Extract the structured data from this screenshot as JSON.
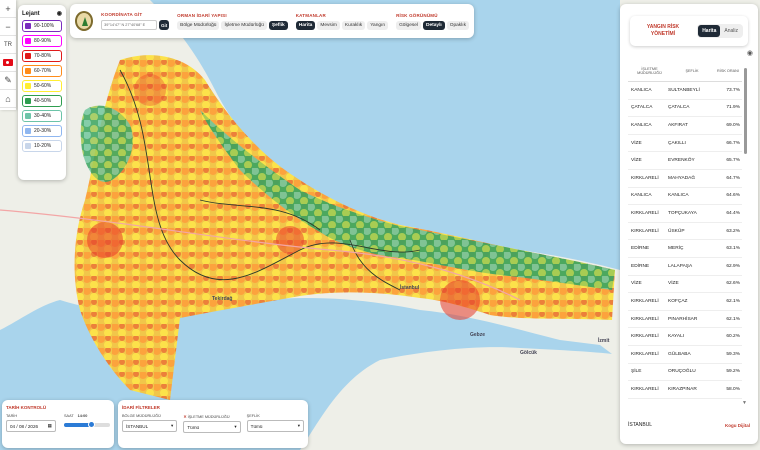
{
  "toolbar_left": {
    "zoom_in": "+",
    "zoom_out": "−",
    "lang": "TR"
  },
  "legend": {
    "title": "Lejant",
    "items": [
      {
        "label": "90-100%",
        "color": "#7b2cbf"
      },
      {
        "label": "80-90%",
        "color": "#ff00ff"
      },
      {
        "label": "70-80%",
        "color": "#e01a1a"
      },
      {
        "label": "60-70%",
        "color": "#ff8c1a"
      },
      {
        "label": "50-60%",
        "color": "#ffee33"
      },
      {
        "label": "40-50%",
        "color": "#2e9e4f"
      },
      {
        "label": "30-40%",
        "color": "#6cc4a8"
      },
      {
        "label": "20-30%",
        "color": "#8fb7f0"
      },
      {
        "label": "10-20%",
        "color": "#c8d6ea"
      }
    ]
  },
  "topbar": {
    "coord_title": "KOORDİNATA GİT",
    "coord_placeholder": "39°14'47\" N 27°40'68\" E",
    "go_label": "Git",
    "unit_title": "ORMAN İDARİ YAPISI",
    "unit_buttons": [
      "Bölge Müdürlüğü",
      "İşletme Müdürlüğü",
      "Şeflik"
    ],
    "layers_title": "KATMANLAR",
    "layer_buttons": [
      "Harita",
      "Mevsim",
      "Kuraklık",
      "Yangın"
    ],
    "view_title": "RİSK GÖRÜNÜMÜ",
    "view_buttons": [
      "Gölgesel",
      "Detaylı",
      "Opaklık"
    ]
  },
  "right_panel": {
    "title": "YANGIN RİSK YÖNETİMİ",
    "tabs": [
      "Harita",
      "Analiz"
    ],
    "columns": [
      "İŞLETME MÜDÜRLÜĞÜ",
      "ŞEFLİK",
      "RİSK ORANI"
    ],
    "rows": [
      [
        "KANLICA",
        "SULTANBEYLİ",
        "73.7%"
      ],
      [
        "ÇATALCA",
        "ÇATALCA",
        "71.9%"
      ],
      [
        "KANLICA",
        "AKFIRAT",
        "69.0%"
      ],
      [
        "VİZE",
        "ÇAKILLI",
        "66.7%"
      ],
      [
        "VİZE",
        "EVRENKÖY",
        "65.7%"
      ],
      [
        "KIRKLARELİ",
        "MAHYADAĞ",
        "64.7%"
      ],
      [
        "KANLICA",
        "KANLICA",
        "64.6%"
      ],
      [
        "KIRKLARELİ",
        "TOPÇUKAYA",
        "64.4%"
      ],
      [
        "KIRKLARELİ",
        "ÜSKÜP",
        "63.2%"
      ],
      [
        "EDİRNE",
        "MERİÇ",
        "63.1%"
      ],
      [
        "EDİRNE",
        "LALAPAŞA",
        "62.9%"
      ],
      [
        "VİZE",
        "VİZE",
        "62.6%"
      ],
      [
        "KIRKLARELİ",
        "KOFÇAZ",
        "62.1%"
      ],
      [
        "KIRKLARELİ",
        "PINARHİSAR",
        "62.1%"
      ],
      [
        "KIRKLARELİ",
        "KAYALI",
        "60.2%"
      ],
      [
        "KIRKLARELİ",
        "GÜLBABA",
        "59.3%"
      ],
      [
        "ŞİLE",
        "ORUÇOĞLU",
        "59.2%"
      ],
      [
        "KIRKLARELİ",
        "KIRAZPINAR",
        "58.0%"
      ]
    ],
    "footer_region": "İSTANBUL",
    "brand": "Kogu Dijital"
  },
  "date_panel": {
    "title": "TARİH KONTROLÜ",
    "date_label": "TARİH",
    "date_value": "04 / 08 / 2026",
    "time_label": "SAAT",
    "time_value": "14:00",
    "time_progress": 0.58
  },
  "filter_panel": {
    "title": "İDARİ FİLTRELER",
    "region_label": "BÖLGE MÜDÜRLÜĞÜ",
    "region_value": "İSTANBUL",
    "unit_label": "İŞLETME MÜDÜRLÜĞÜ",
    "unit_value": "Tümü",
    "chief_label": "ŞEFLİK",
    "chief_value": "Tümü"
  },
  "map_labels": {
    "istanbul": "İstanbul",
    "tekirdag": "Tekirdağ",
    "gebze": "Gebze",
    "golcuk": "Gölcük",
    "izmit": "İzmit"
  }
}
